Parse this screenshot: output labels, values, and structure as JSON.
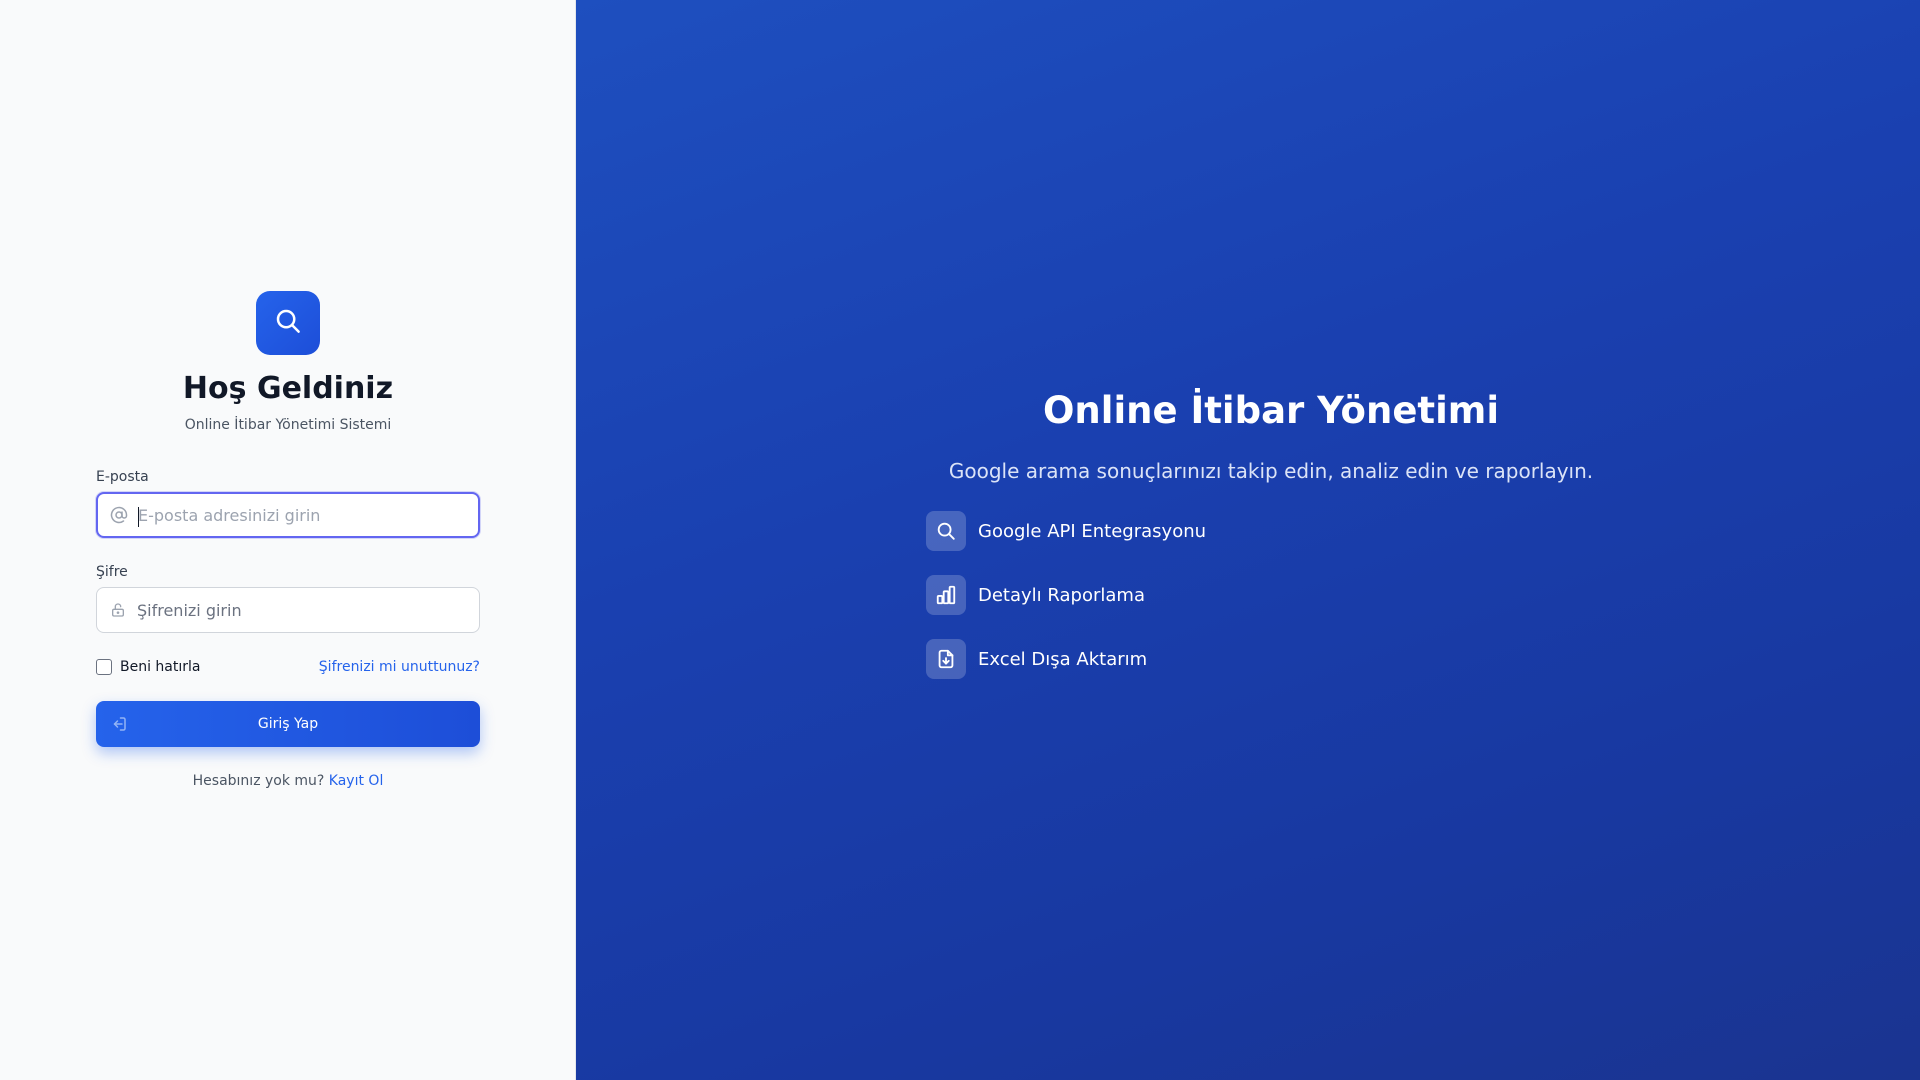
{
  "login": {
    "logo_icon": "search-icon",
    "title": "Hoş Geldiniz",
    "subtitle": "Online İtibar Yönetimi Sistemi",
    "email": {
      "label": "E-posta",
      "placeholder": "E-posta adresinizi girin",
      "value": "",
      "icon": "at-icon"
    },
    "password": {
      "label": "Şifre",
      "placeholder": "Şifrenizi girin",
      "value": "",
      "icon": "lock-icon"
    },
    "remember_label": "Beni hatırla",
    "remember_checked": false,
    "forgot_label": "Şifrenizi mi unuttunuz?",
    "submit_label": "Giriş Yap",
    "submit_icon": "sign-in-icon",
    "no_account_text": "Hesabınız yok mu?",
    "signup_label": "Kayıt Ol"
  },
  "hero": {
    "title": "Online İtibar Yönetimi",
    "subtitle": "Google arama sonuçlarınızı takip edin, analiz edin ve raporlayın.",
    "features": [
      {
        "label": "Google API Entegrasyonu",
        "icon": "search-icon"
      },
      {
        "label": "Detaylı Raporlama",
        "icon": "bar-chart-icon"
      },
      {
        "label": "Excel Dışa Aktarım",
        "icon": "file-download-icon"
      }
    ]
  },
  "colors": {
    "accent": "#2563eb",
    "focus_ring": "#6366f1",
    "hero_bg": "#1e40af"
  }
}
